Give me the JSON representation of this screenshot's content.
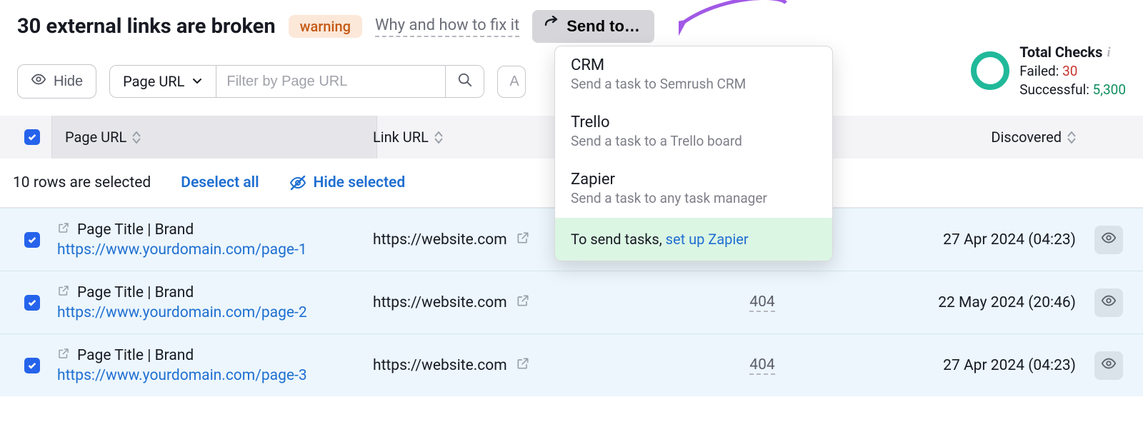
{
  "header": {
    "title": "30 external links are broken",
    "badge": "warning",
    "help": "Why and how to fix it",
    "send_to": "Send to…"
  },
  "stats": {
    "title": "Total Checks",
    "failed_label": "Failed:",
    "failed_value": "30",
    "success_label": "Successful:",
    "success_value": "5,300"
  },
  "toolbar": {
    "hide": "Hide",
    "select_field": "Page URL",
    "filter_placeholder": "Filter by Page URL",
    "truncated_button": "A"
  },
  "dropdown": {
    "items": [
      {
        "title": "CRM",
        "sub": "Send a task to Semrush CRM"
      },
      {
        "title": "Trello",
        "sub": "Send a task to a Trello board"
      },
      {
        "title": "Zapier",
        "sub": "Send a task to any task manager"
      }
    ],
    "footer_prefix": "To send tasks, ",
    "footer_link": "set up Zapier"
  },
  "table": {
    "headers": {
      "page": "Page URL",
      "link": "Link URL",
      "discovered": "Discovered"
    },
    "selection_bar": {
      "text": "10 rows are selected",
      "deselect": "Deselect all",
      "hide_selected": "Hide selected"
    },
    "rows": [
      {
        "page_title": "Page Title | Brand",
        "page_url": "https://www.yourdomain.com/page-1",
        "link_url": "https://website.com",
        "status": "",
        "discovered": "27 Apr 2024 (04:23)"
      },
      {
        "page_title": "Page Title | Brand",
        "page_url": "https://www.yourdomain.com/page-2",
        "link_url": "https://website.com",
        "status": "404",
        "discovered": "22 May 2024 (20:46)"
      },
      {
        "page_title": "Page Title | Brand",
        "page_url": "https://www.yourdomain.com/page-3",
        "link_url": "https://website.com",
        "status": "404",
        "discovered": "27 Apr 2024 (04:23)"
      }
    ]
  }
}
